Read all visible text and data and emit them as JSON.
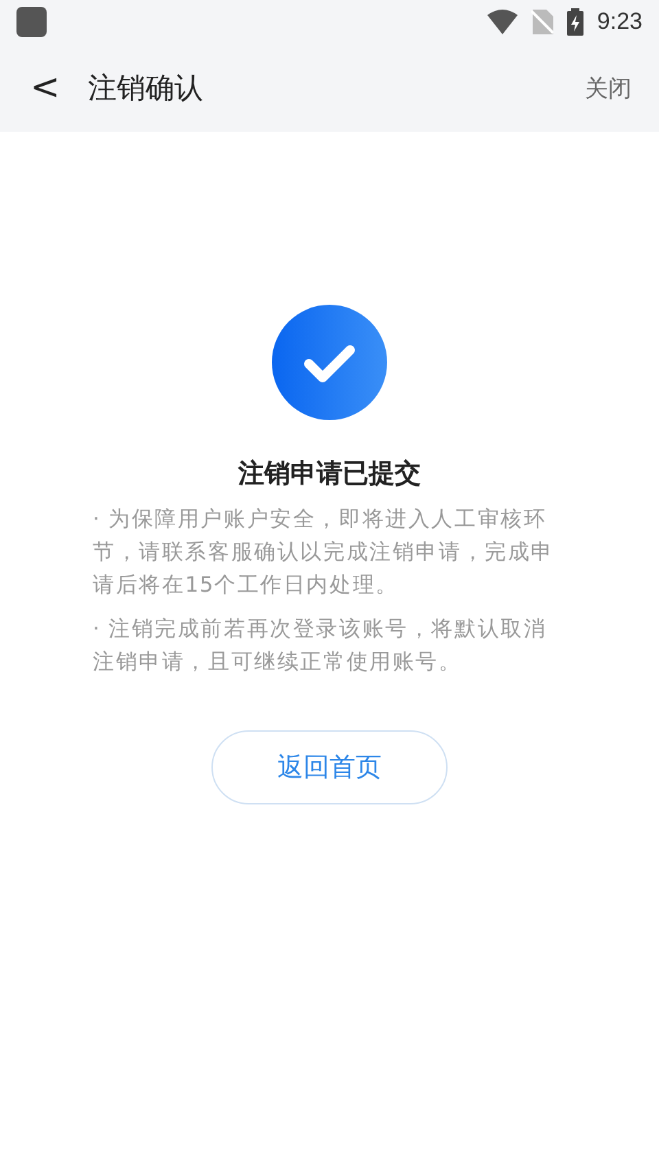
{
  "status_bar": {
    "time": "9:23"
  },
  "header": {
    "back": "<",
    "title": "注销确认",
    "close": "关闭"
  },
  "result": {
    "title": "注销申请已提交",
    "notes": [
      "·  为保障用户账户安全，即将进入人工审核环节，请联系客服确认以完成注销申请，完成申请后将在15个工作日内处理。",
      "·  注销完成前若再次登录该账号，将默认取消注销申请，且可继续正常使用账号。"
    ]
  },
  "button": "返回首页"
}
